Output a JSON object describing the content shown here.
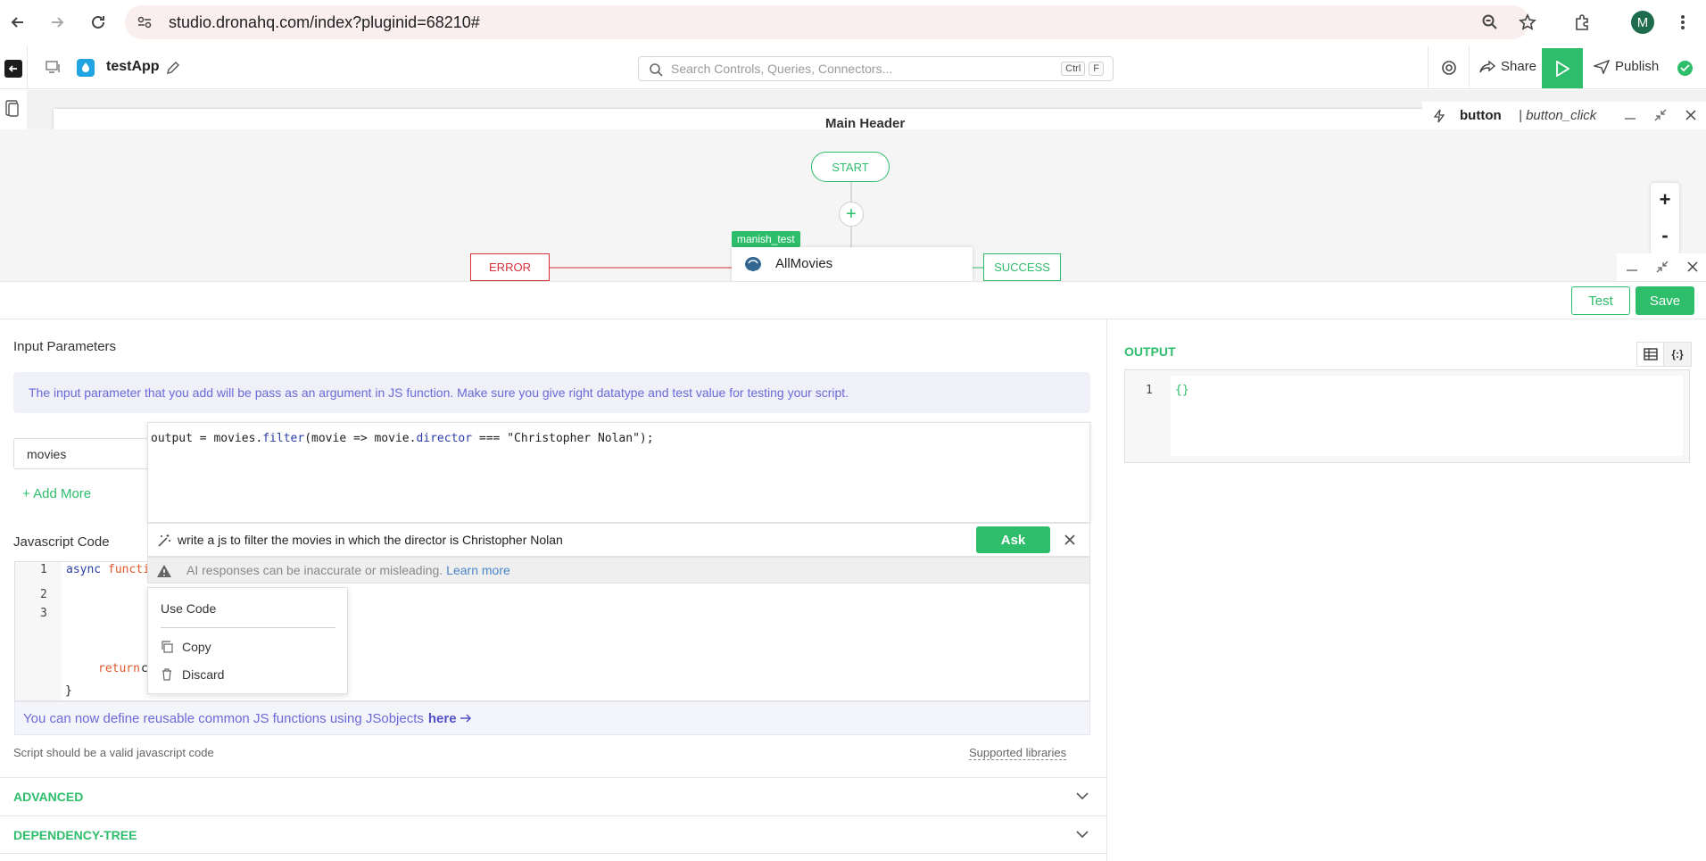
{
  "browser": {
    "url": "studio.dronahq.com/index?pluginid=68210#",
    "profile_initial": "M"
  },
  "header": {
    "app_name": "testApp",
    "search_placeholder": "Search Controls, Queries, Connectors...",
    "shortcut_ctrl": "Ctrl",
    "shortcut_key": "F",
    "share_label": "Share",
    "publish_label": "Publish"
  },
  "canvas": {
    "main_header": "Main Header",
    "action_panel": {
      "control": "button",
      "event": "| button_click"
    }
  },
  "flow": {
    "start_label": "START",
    "add_label": "+",
    "error_label": "ERROR",
    "success_label": "SUCCESS",
    "query_tag": "manish_test",
    "query_name": "AllMovies",
    "zoom_in": "+",
    "zoom_out": "-"
  },
  "editor": {
    "test_label": "Test",
    "save_label": "Save",
    "input_params_title": "Input Parameters",
    "info_text": "The input parameter that you add will be pass as an argument in JS function. Make sure you give right datatype and test value for testing your script.",
    "param_name": "movies",
    "add_more_label": "+ Add More",
    "js_code_title": "Javascript Code",
    "code": {
      "line_numbers": [
        "1",
        "2",
        "3"
      ],
      "async_kw": "async",
      "function_kw": "functi",
      "return_kw": "return",
      "return_rest": "c",
      "closing": "}"
    },
    "jsobjects_text": "You can now define reusable common JS functions using JSobjects",
    "jsobjects_link": "here",
    "script_hint": "Script should be a valid javascript code",
    "supported_libs": "Supported libraries",
    "accordions": [
      "ADVANCED",
      "DEPENDENCY-TREE"
    ]
  },
  "output": {
    "title": "OUTPUT",
    "line_number": "1",
    "value": "{}",
    "json_icon_label": "{:}"
  },
  "ai_assist": {
    "generated_code": {
      "prefix": "output = movies.",
      "method": "filter",
      "middle": "(movie => movie.",
      "prop": "director",
      "suffix": " === \"Christopher Nolan\");"
    },
    "prompt": "write a js to filter the movies in which the director is Christopher Nolan",
    "ask_label": "Ask",
    "warning": "AI responses can be inaccurate or misleading.",
    "learn_more": "Learn more",
    "menu": {
      "use_code": "Use Code",
      "copy": "Copy",
      "discard": "Discard"
    }
  },
  "colors": {
    "accent": "#2ebd6b",
    "error": "#d9303b",
    "info_text": "#6a6ad8"
  }
}
